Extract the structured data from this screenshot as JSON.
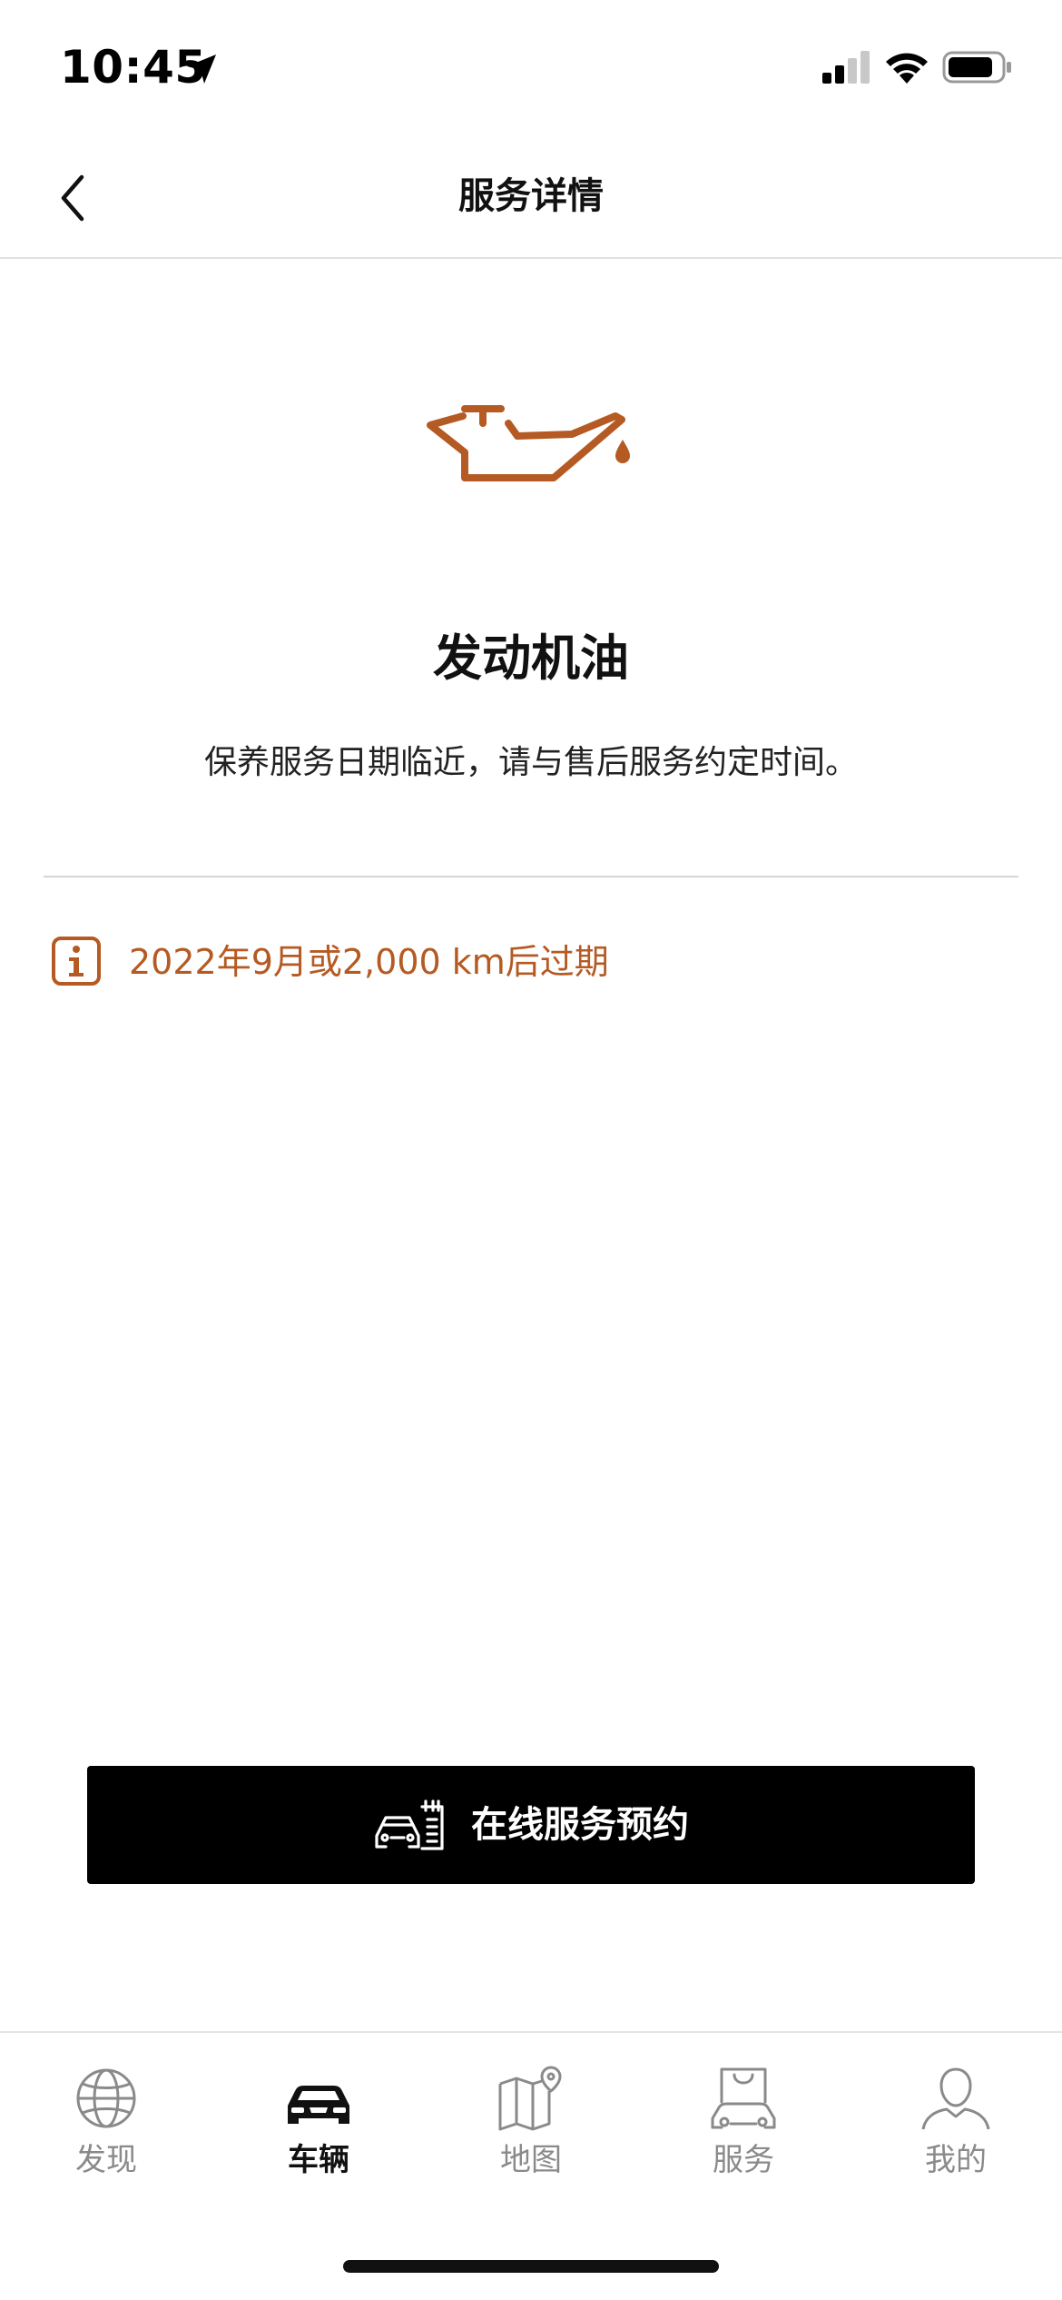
{
  "status_bar": {
    "time": "10:45"
  },
  "nav": {
    "title": "服务详情"
  },
  "service": {
    "title": "发动机油",
    "description": "保养服务日期临近，请与售后服务约定时间。",
    "due_text": "2022年9月或2,000 km后过期"
  },
  "cta": {
    "label": "在线服务预约"
  },
  "tabs": [
    {
      "label": "发现",
      "icon": "globe-icon"
    },
    {
      "label": "车辆",
      "icon": "car-icon",
      "active": true
    },
    {
      "label": "地图",
      "icon": "map-icon"
    },
    {
      "label": "服务",
      "icon": "service-bag-icon"
    },
    {
      "label": "我的",
      "icon": "person-icon"
    }
  ],
  "colors": {
    "accent": "#B55A23",
    "button_bg": "#000000",
    "tab_inactive": "#8A8A8A"
  }
}
